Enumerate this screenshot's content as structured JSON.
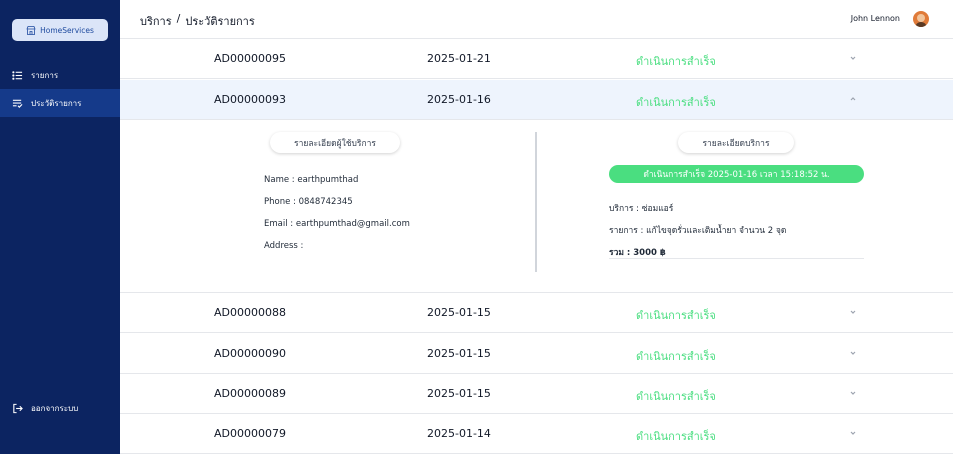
{
  "sidebar": {
    "brand": "HomeServices",
    "items": [
      {
        "label": "รายการ"
      },
      {
        "label": "ประวัติรายการ"
      }
    ],
    "logout": "ออกจากระบบ",
    "active_color": "#153a8a",
    "bg_color": "#0c2461"
  },
  "header": {
    "breadcrumb_root": "บริการ",
    "breadcrumb_sep": "/",
    "breadcrumb_current": "ประวัติรายการ",
    "user_name": "John Lennon"
  },
  "rows": [
    {
      "id": "AD00000095",
      "date": "2025-01-21",
      "status": "ดำเนินการสำเร็จ"
    },
    {
      "id": "AD00000093",
      "date": "2025-01-16",
      "status": "ดำเนินการสำเร็จ"
    },
    {
      "id": "AD00000088",
      "date": "2025-01-15",
      "status": "ดำเนินการสำเร็จ"
    },
    {
      "id": "AD00000090",
      "date": "2025-01-15",
      "status": "ดำเนินการสำเร็จ"
    },
    {
      "id": "AD00000089",
      "date": "2025-01-15",
      "status": "ดำเนินการสำเร็จ"
    },
    {
      "id": "AD00000079",
      "date": "2025-01-14",
      "status": "ดำเนินการสำเร็จ"
    }
  ],
  "details": {
    "user_title": "รายละเอียดผู้ใช้บริการ",
    "service_title": "รายละเอียดบริการ",
    "name": "Name : earthpumthad",
    "phone": "Phone : 0848742345",
    "email": "Email : earthpumthad@gmail.com",
    "address": "Address :",
    "status_banner": "ดำเนินการสำเร็จ 2025-01-16 เวลา 15:18:52 น.",
    "service": "บริการ : ซ่อมแอร์",
    "items": "รายการ : แก้ไขจุดรั่วและเติมน้ำยา จำนวน 2 จุด",
    "total": "รวม : 3000 ฿"
  },
  "colors": {
    "status_green": "#4ade80",
    "expanded_row_bg": "#eef4fd"
  }
}
